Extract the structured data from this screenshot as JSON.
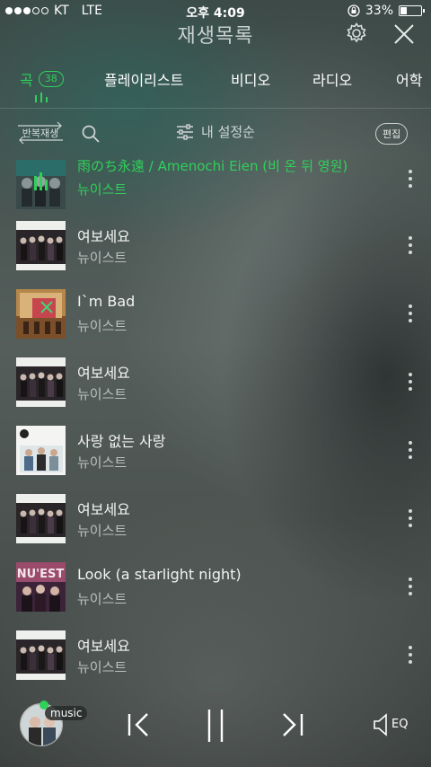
{
  "status_bar": {
    "carrier": "KT",
    "network": "LTE",
    "time": "오후 4:09",
    "battery_pct": "33%",
    "battery_level": 0.33
  },
  "header": {
    "title": "재생목록",
    "icons": [
      "gear-icon",
      "close-icon"
    ]
  },
  "tabs": [
    {
      "label": "곡",
      "count": "38",
      "active": true
    },
    {
      "label": "플레이리스트"
    },
    {
      "label": "비디오"
    },
    {
      "label": "라디오"
    },
    {
      "label": "어학"
    }
  ],
  "toolbar": {
    "repeat_label": "반복재생",
    "sort_label": "내 설정순",
    "edit_label": "편집"
  },
  "songs": [
    {
      "title": "雨のち永遠 / Amenochi Eien (비 온 뒤 영원)",
      "artist": "뉴이스트",
      "playing": true
    },
    {
      "title": "여보세요",
      "artist": "뉴이스트"
    },
    {
      "title": "I`m Bad",
      "artist": "뉴이스트"
    },
    {
      "title": "여보세요",
      "artist": "뉴이스트"
    },
    {
      "title": "사랑 없는 사랑",
      "artist": "뉴이스트"
    },
    {
      "title": "여보세요",
      "artist": "뉴이스트"
    },
    {
      "title": "Look (a starlight night)",
      "artist": "뉴이스트"
    },
    {
      "title": "여보세요",
      "artist": "뉴이스트"
    }
  ],
  "player": {
    "music_tag": "music",
    "eq_label": "EQ"
  },
  "colors": {
    "accent": "#2fd15a",
    "text": "#ffffff",
    "subtext": "#b9c1bf"
  }
}
